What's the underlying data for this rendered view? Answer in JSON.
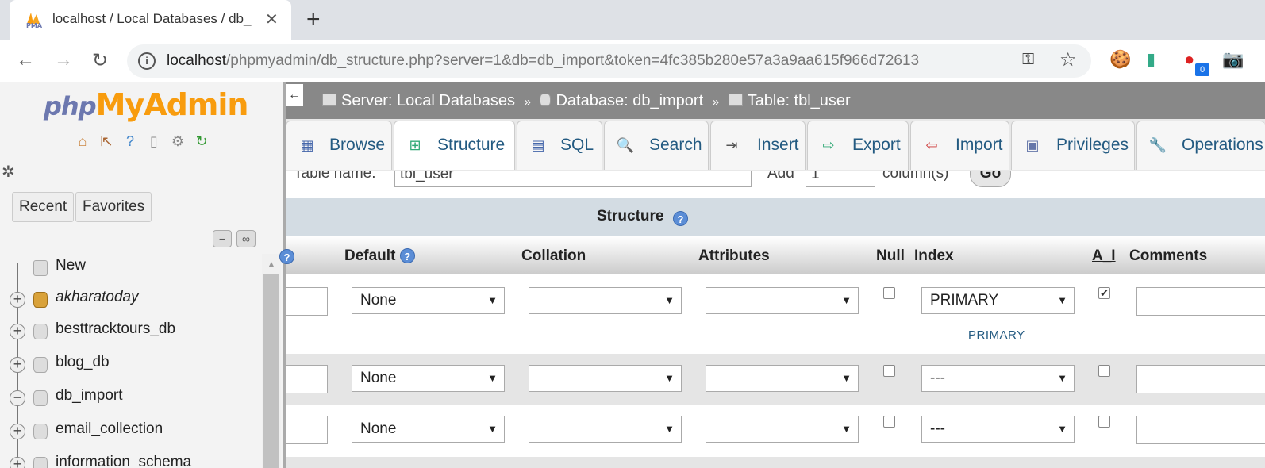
{
  "browser": {
    "tab_title": "localhost / Local Databases / db_",
    "tab_close": "✕",
    "new_tab": "+",
    "url_host": "localhost",
    "url_path": "/phpmyadmin/db_structure.php?server=1&db=db_import&token=4fc385b280e57a3a9aa615f966d72613",
    "extension_badge": "0"
  },
  "sidebar": {
    "logo_php": "php",
    "logo_my": "My",
    "logo_admin": "Admin",
    "tabs": [
      "Recent",
      "Favorites"
    ],
    "tree": [
      {
        "label": "New",
        "expander": "",
        "italic": false
      },
      {
        "label": "akharatoday",
        "expander": "+",
        "italic": true
      },
      {
        "label": "besttracktours_db",
        "expander": "+",
        "italic": false
      },
      {
        "label": "blog_db",
        "expander": "+",
        "italic": false
      },
      {
        "label": "db_import",
        "expander": "−",
        "italic": false
      },
      {
        "label": "email_collection",
        "expander": "+",
        "italic": false
      },
      {
        "label": "information_schema",
        "expander": "+",
        "italic": false
      }
    ]
  },
  "breadcrumb": {
    "back": "←",
    "server": "Server: Local Databases",
    "database": "Database: db_import",
    "table": "Table: tbl_user",
    "sep": "»"
  },
  "menu": [
    {
      "label": "Browse",
      "icon": "▦"
    },
    {
      "label": "Structure",
      "icon": "⊞"
    },
    {
      "label": "SQL",
      "icon": "▤"
    },
    {
      "label": "Search",
      "icon": "🔍"
    },
    {
      "label": "Insert",
      "icon": "⇥"
    },
    {
      "label": "Export",
      "icon": "⇨"
    },
    {
      "label": "Import",
      "icon": "⇦"
    },
    {
      "label": "Privileges",
      "icon": "▣"
    },
    {
      "label": "Operations",
      "icon": "🔧"
    }
  ],
  "table_form": {
    "table_name_label": "Table name:",
    "table_name_value": "tbl_user",
    "add_label": "Add",
    "add_value": "1",
    "columns_label": "column(s)",
    "go_label": "Go"
  },
  "structure": {
    "title": "Structure",
    "headers": {
      "default": "Default",
      "collation": "Collation",
      "attributes": "Attributes",
      "null": "Null",
      "index": "Index",
      "ai": "A_I",
      "comments": "Comments"
    },
    "rows": [
      {
        "default": "None",
        "collation": "",
        "attributes": "",
        "null": false,
        "index": "PRIMARY",
        "ai": true,
        "index_link": "PRIMARY"
      },
      {
        "default": "None",
        "collation": "",
        "attributes": "",
        "null": false,
        "index": "---",
        "ai": false
      },
      {
        "default": "None",
        "collation": "",
        "attributes": "",
        "null": false,
        "index": "---",
        "ai": false
      }
    ]
  },
  "colors": {
    "accent_link": "#235a81",
    "breadcrumb_bg": "#888888",
    "section_bg": "#d3dce3"
  }
}
